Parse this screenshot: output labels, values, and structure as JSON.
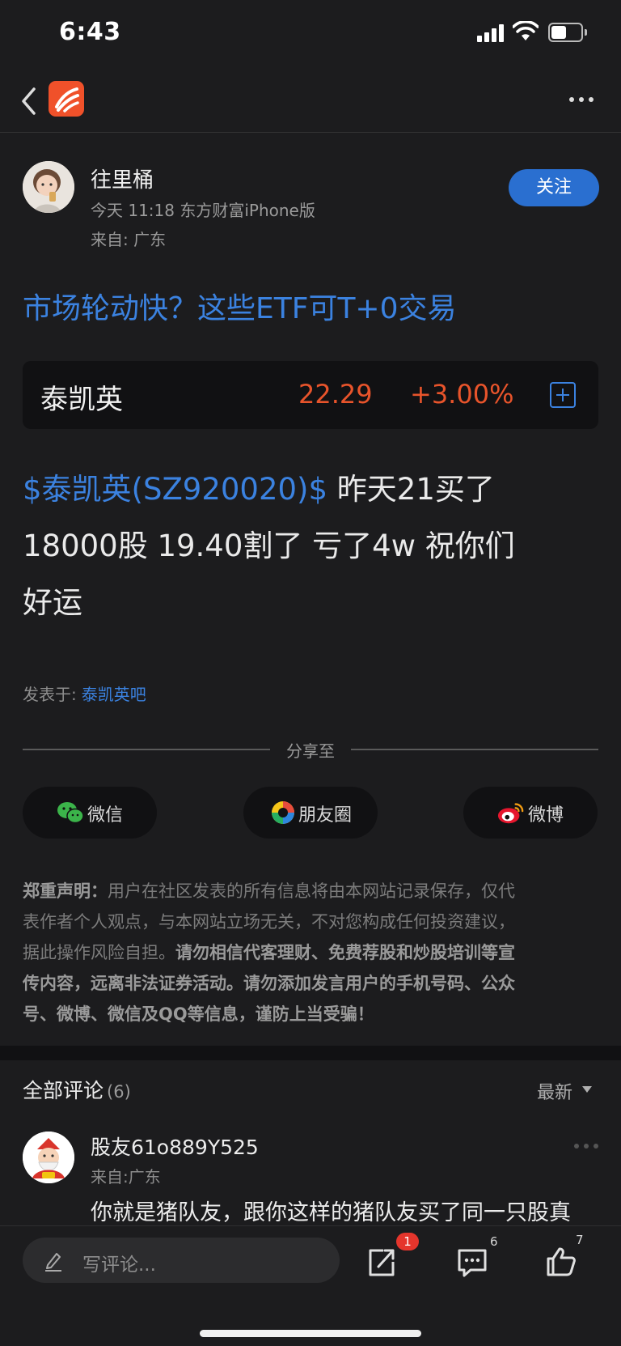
{
  "status_bar": {
    "time": "6:43"
  },
  "author": {
    "name": "往里桶",
    "meta": "今天 11:18  东方财富iPhone版",
    "location": "来自: 广东",
    "follow_label": "关注"
  },
  "post": {
    "title": "市场轮动快？这些ETF可T+0交易",
    "stock": {
      "name": "泰凯英",
      "price": "22.29",
      "change": "+3.00%"
    },
    "body": {
      "stock_tag": "$泰凯英(SZ920020)$",
      "line1_rest": "  昨天21买了",
      "line2": "18000股  19.40割了  亏了4w     祝你们",
      "line3": "好运"
    },
    "posted_in_label": "发表于:",
    "posted_in_bar": "泰凯英吧"
  },
  "share": {
    "label": "分享至",
    "wechat": "微信",
    "moments": "朋友圈",
    "weibo": "微博"
  },
  "disclaimer": {
    "title": "郑重声明：",
    "line1": "用户在社区发表的所有信息将由本网站记录保存，仅代",
    "line2": "表作者个人观点，与本网站立场无关，不对您构成任何投资建议，",
    "line3_normal": "据此操作风险自担。",
    "line3_bold": "请勿相信代客理财、免费荐股和炒股培训等宣",
    "line4": "传内容，远离非法证券活动。请勿添加发言用户的手机号码、公众",
    "line5": "号、微博、微信及QQ等信息，谨防上当受骗！"
  },
  "comments": {
    "title": "全部评论",
    "count": "(6)",
    "sort": "最新",
    "items": [
      {
        "name": "股友61o889Y525",
        "location": "来自:广东",
        "text": "你就是猪队友，跟你这样的猪队友买了同一只股真"
      }
    ]
  },
  "bottom_bar": {
    "input_placeholder": "写评论...",
    "share_badge": "1",
    "comment_count": "6",
    "like_count": "7"
  },
  "colors": {
    "accent": "#3b82e0",
    "up": "#e8542b",
    "background": "#1c1c1e",
    "follow_button": "#2a6fd0",
    "badge": "#e5352c"
  }
}
